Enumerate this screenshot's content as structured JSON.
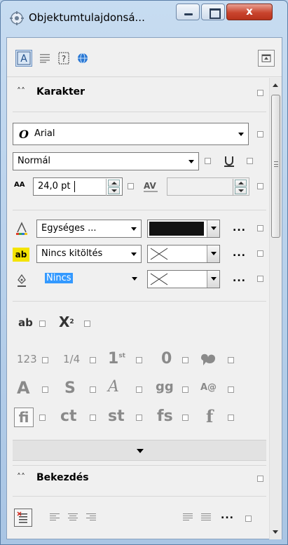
{
  "window": {
    "title": "Objektumtulajdonsá...",
    "close_label": "x"
  },
  "sections": {
    "character": {
      "title": "Karakter"
    },
    "paragraph": {
      "title": "Bekezdés"
    }
  },
  "font": {
    "family": "Arial",
    "style": "Normál",
    "size": "24,0 pt",
    "spacing": ""
  },
  "fill": {
    "color_mode": "Egységes ...",
    "color": "#121212",
    "background_mode": "Nincs kitöltés",
    "outline_mode": "Nincs"
  },
  "more_label": "...",
  "icons": {
    "font_preview": "O",
    "size_glyph": "AA",
    "subscript_glyph": "ab",
    "superscript_glyph": "X",
    "superscript_mark": "2",
    "numeral": "123",
    "fraction": "1/4",
    "ordinal": "1",
    "ordinal_mark": "st",
    "zero": "0",
    "caps": "A",
    "small_caps": "S",
    "swash": "A",
    "gg": "gg",
    "ae": "A@",
    "ligature": "fi",
    "ct": "ct",
    "st": "st",
    "fs": "fs",
    "f": "f"
  },
  "colors": {
    "accent": "#3399ff",
    "window_frame": "#a9c5e4"
  }
}
